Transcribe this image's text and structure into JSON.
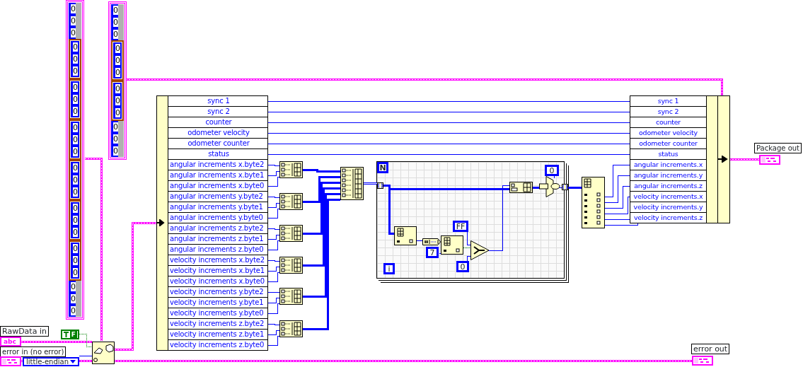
{
  "array_constant_a": {
    "items": [
      {
        "kind": "element",
        "value": "0"
      },
      {
        "kind": "element",
        "value": "0"
      },
      {
        "kind": "element",
        "value": "0"
      },
      {
        "kind": "cluster",
        "values": [
          "0",
          "0",
          "0"
        ]
      },
      {
        "kind": "cluster",
        "values": [
          "0",
          "0",
          "0"
        ]
      },
      {
        "kind": "cluster",
        "values": [
          "0",
          "0",
          "0"
        ]
      },
      {
        "kind": "cluster",
        "values": [
          "0",
          "0",
          "0"
        ]
      },
      {
        "kind": "cluster",
        "values": [
          "0",
          "0",
          "0"
        ]
      },
      {
        "kind": "cluster",
        "values": [
          "0",
          "0",
          "0"
        ]
      },
      {
        "kind": "element",
        "value": "0"
      },
      {
        "kind": "element",
        "value": "0"
      },
      {
        "kind": "element",
        "value": "0"
      }
    ]
  },
  "array_constant_b": {
    "items": [
      {
        "kind": "element",
        "value": "0"
      },
      {
        "kind": "element",
        "value": "0"
      },
      {
        "kind": "element",
        "value": "0"
      },
      {
        "kind": "cluster",
        "values": [
          "0",
          "0",
          "0"
        ]
      },
      {
        "kind": "cluster",
        "values": [
          "0",
          "0",
          "0"
        ]
      },
      {
        "kind": "element",
        "value": "0"
      },
      {
        "kind": "element",
        "value": "0"
      },
      {
        "kind": "element",
        "value": "0"
      }
    ]
  },
  "unbundle": {
    "fields": [
      "sync 1",
      "sync 2",
      "counter",
      "odometer velocity",
      "odometer counter",
      "status",
      "angular increments x.byte2",
      "angular increments x.byte1",
      "angular increments x.byte0",
      "angular increments y.byte2",
      "angular increments y.byte1",
      "angular increments y.byte0",
      "angular increments z.byte2",
      "angular increments z.byte1",
      "angular increments z.byte0",
      "velocity increments x.byte2",
      "velocity increments x.byte1",
      "velocity increments x.byte0",
      "velocity increments y.byte2",
      "velocity increments y.byte1",
      "velocity increments y.byte0",
      "velocity increments z.byte2",
      "velocity increments z.byte1",
      "velocity increments z.byte0"
    ]
  },
  "for_loop": {
    "count_terminal": "N",
    "iteration_terminal": "i",
    "constants": [
      "7",
      "FF",
      "0",
      "0"
    ]
  },
  "bundle": {
    "fields": [
      "sync 1",
      "sync 2",
      "counter",
      "odometer velocity",
      "odometer counter",
      "status",
      "angular increments.x",
      "angular increments.y",
      "angular increments.z",
      "velocity increments.x",
      "velocity increments.y",
      "velocity increments.z"
    ]
  },
  "boolean_constant": {
    "value": "F"
  },
  "raw_data_in": {
    "label": "RawData in",
    "glyph": "abc"
  },
  "error_in": {
    "label": "error in (no error)"
  },
  "endian": {
    "value": "little-endian"
  },
  "package_out": {
    "label": "Package out"
  },
  "error_out": {
    "label": "error out"
  }
}
